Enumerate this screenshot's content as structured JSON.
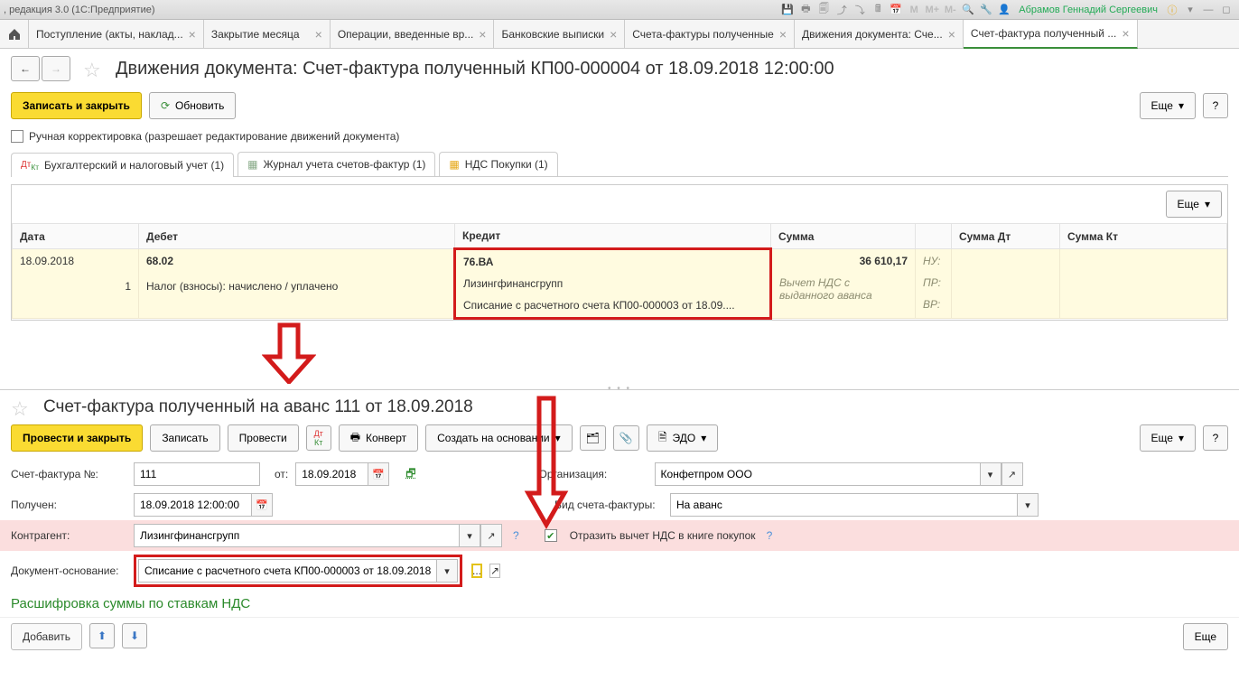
{
  "titlebar": {
    "left_text": ", редакция 3.0  (1С:Предприятие)",
    "user": "Абрамов Геннадий Сергеевич",
    "m_buttons": [
      "M",
      "M+",
      "M-"
    ]
  },
  "tabs": [
    {
      "label": "Поступление (акты, наклад..."
    },
    {
      "label": "Закрытие месяца"
    },
    {
      "label": "Операции, введенные вр..."
    },
    {
      "label": "Банковские выписки"
    },
    {
      "label": "Счета-фактуры полученные"
    },
    {
      "label": "Движения документа: Сче..."
    },
    {
      "label": "Счет-фактура полученный ...",
      "active": true
    }
  ],
  "pane1": {
    "title": "Движения документа: Счет-фактура полученный КП00-000004 от 18.09.2018 12:00:00",
    "save_close": "Записать и закрыть",
    "refresh": "Обновить",
    "more": "Еще",
    "checkbox_label": "Ручная корректировка (разрешает редактирование движений документа)",
    "subtabs": [
      "Бухгалтерский и налоговый учет (1)",
      "Журнал учета счетов-фактур (1)",
      "НДС Покупки (1)"
    ],
    "table": {
      "headers": {
        "date": "Дата",
        "debit": "Дебет",
        "credit": "Кредит",
        "sum": "Сумма",
        "sum_dt": "Сумма Дт",
        "sum_kt": "Сумма Кт"
      },
      "row": {
        "date": "18.09.2018",
        "num": "1",
        "debit_acc": "68.02",
        "debit_text": "Налог (взносы): начислено / уплачено",
        "credit_acc": "76.ВА",
        "credit_line1": "Лизингфинансгрупп",
        "credit_line2": "Списание с расчетного счета КП00-000003 от 18.09....",
        "sum": "36 610,17",
        "sum_text1": "Вычет НДС с",
        "sum_text2": "выданного аванса",
        "tags": {
          "nu": "НУ:",
          "pr": "ПР:",
          "vr": "ВР:"
        }
      }
    }
  },
  "pane2": {
    "title": "Счет-фактура полученный на аванс 111 от 18.09.2018",
    "post_close": "Провести и закрыть",
    "write": "Записать",
    "post": "Провести",
    "convert": "Конверт",
    "create_based": "Создать на основании",
    "edo": "ЭДО",
    "more": "Еще",
    "labels": {
      "invoice_no": "Счет-фактура №:",
      "from": "от:",
      "received": "Получен:",
      "counterparty": "Контрагент:",
      "basis_doc": "Документ-основание:",
      "org": "Организация:",
      "invoice_type": "Вид счета-фактуры:",
      "reflect_nds": "Отразить вычет НДС в книге покупок"
    },
    "values": {
      "invoice_no": "111",
      "from_date": "18.09.2018",
      "received": "18.09.2018 12:00:00",
      "counterparty": "Лизингфинансгрупп",
      "basis_doc": "Списание с расчетного счета КП00-000003 от 18.09.2018",
      "org": "Конфетпром ООО",
      "invoice_type": "На аванс"
    },
    "section": "Расшифровка суммы по ставкам НДС",
    "add": "Добавить"
  }
}
